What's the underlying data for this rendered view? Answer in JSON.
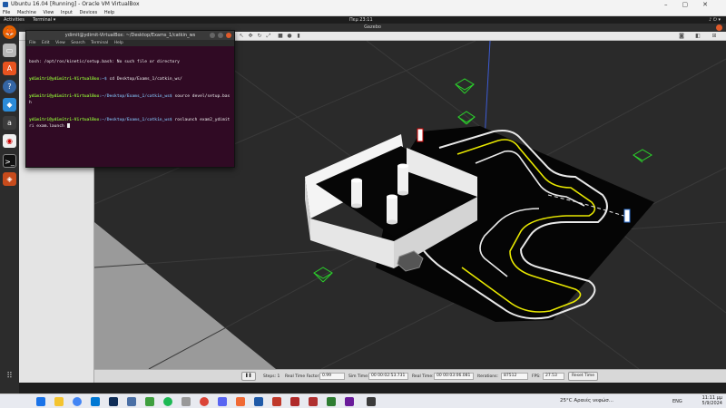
{
  "vbox": {
    "title": "Ubuntu 16.04 [Running] - Oracle VM VirtualBox",
    "menu": [
      "File",
      "Machine",
      "View",
      "Input",
      "Devices",
      "Help"
    ]
  },
  "ubuntu": {
    "activities": "Activities",
    "app_menu": "Terminal ▾",
    "clock": "Πεμ 23:11",
    "tray": "♪ ⏻ ▾"
  },
  "gazebo": {
    "window_title": "Gazebo",
    "status": {
      "steps_label": "Steps: 1",
      "rtf_label": "Real Time Factor:",
      "rtf_value": "0.99",
      "sim_time_label": "Sim Time:",
      "sim_time_value": "00 00:02:53.731",
      "real_time_label": "Real Time:",
      "real_time_value": "00 00:03:06.081",
      "iterations_label": "Iterations:",
      "iterations_value": "87512",
      "fps_label": "FPS:",
      "fps_value": "27.53",
      "reset_label": "Reset Time"
    }
  },
  "terminal": {
    "title": "ydimit@ydimit-VirtualBox: ~/Desktop/Exams_1/catkin_ws",
    "menu": [
      "File",
      "Edit",
      "View",
      "Search",
      "Terminal",
      "Help"
    ],
    "lines": [
      {
        "prompt": "",
        "path": "",
        "text": "bash: /opt/ros/kinetic/setup.bash: No such file or directory"
      },
      {
        "prompt": "ydimitri@ydimitri-VirtualBox",
        "path": ":~$",
        "text": " cd Desktop/Exams_1/catkin_ws/"
      },
      {
        "prompt": "ydimitri@ydimitri-VirtualBox",
        "path": ":~/Desktop/Exams_1/catkin_ws$",
        "text": " source devel/setup.bash"
      },
      {
        "prompt": "ydimitri@ydimitri-VirtualBox",
        "path": ":~/Desktop/Exams_1/catkin_ws$",
        "text": " roslaunch exam2_ydimitri exam.launch"
      }
    ]
  },
  "windows": {
    "weather": "25°C  Αραιές νεφώσ...",
    "lang": "ENG",
    "time": "11:11 μμ",
    "date": "5/9/2024"
  },
  "colors": {
    "terminal_bg": "#300a24",
    "floor": "#1f1f1f",
    "track_line": "#f0f000",
    "marker": "#2bd12b"
  }
}
